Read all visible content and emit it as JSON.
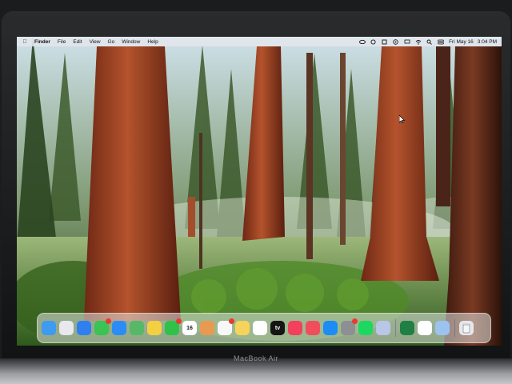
{
  "menubar": {
    "app_name": "Finder",
    "items": [
      "File",
      "Edit",
      "View",
      "Go",
      "Window",
      "Help"
    ],
    "date": "Fri May 16",
    "time": "3:04 PM"
  },
  "status_icons": [
    "creative-cloud-icon",
    "sync-icon",
    "notes-icon",
    "play-icon",
    "screen-mirroring-icon",
    "wifi-icon",
    "search-icon",
    "control-center-icon"
  ],
  "dock": {
    "apps": [
      {
        "name": "finder",
        "color": "#3e9bf0"
      },
      {
        "name": "launchpad",
        "color": "#e8e8ee"
      },
      {
        "name": "safari",
        "color": "#2f7ff0"
      },
      {
        "name": "messages",
        "color": "#39c453",
        "badge": true
      },
      {
        "name": "mail",
        "color": "#2b8cf5"
      },
      {
        "name": "maps",
        "color": "#57b867"
      },
      {
        "name": "photos",
        "color": "#f3d042"
      },
      {
        "name": "facetime",
        "color": "#2fc24a",
        "badge": true
      },
      {
        "name": "calendar",
        "color": "#ffffff"
      },
      {
        "name": "contacts",
        "color": "#e89a52"
      },
      {
        "name": "reminders",
        "color": "#f8f8f8",
        "badge": true
      },
      {
        "name": "notes",
        "color": "#f6d35b"
      },
      {
        "name": "freeform",
        "color": "#ffffff"
      },
      {
        "name": "apple-tv",
        "color": "#151515"
      },
      {
        "name": "music",
        "color": "#f3405c"
      },
      {
        "name": "news",
        "color": "#f14e5d"
      },
      {
        "name": "app-store",
        "color": "#1d8cf4"
      },
      {
        "name": "system-settings",
        "color": "#8e8f93",
        "badge": true
      },
      {
        "name": "spotify",
        "color": "#1ed760"
      },
      {
        "name": "preview",
        "color": "#b8c6e8"
      }
    ],
    "recent_apps": [
      {
        "name": "excel",
        "color": "#1f7f45"
      },
      {
        "name": "chrome",
        "color": "#ffffff"
      },
      {
        "name": "preview-document",
        "color": "#9cc3f0"
      }
    ],
    "calendar_day": "16",
    "apple_tv_label": "tv",
    "trash": {
      "name": "trash",
      "color": "#e6e8ec"
    }
  },
  "bezel_label": "MacBook Air"
}
